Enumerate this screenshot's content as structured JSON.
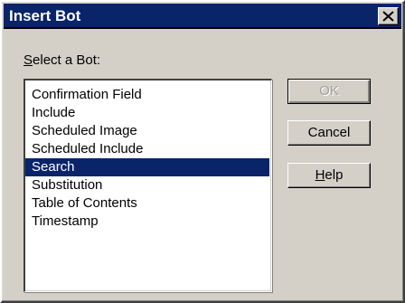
{
  "window": {
    "title": "Insert Bot",
    "close_icon": "close-icon"
  },
  "label": {
    "access_key": "S",
    "rest": "elect a Bot:"
  },
  "list": {
    "items": [
      "Confirmation Field",
      "Include",
      "Scheduled Image",
      "Scheduled Include",
      "Search",
      "Substitution",
      "Table of Contents",
      "Timestamp"
    ],
    "selected": "Search"
  },
  "buttons": {
    "ok": "OK",
    "cancel": "Cancel",
    "help_access_key": "H",
    "help_rest": "elp"
  },
  "colors": {
    "titlebar": "#0a246a",
    "face": "#d4d0c8",
    "selection": "#0a246a"
  }
}
